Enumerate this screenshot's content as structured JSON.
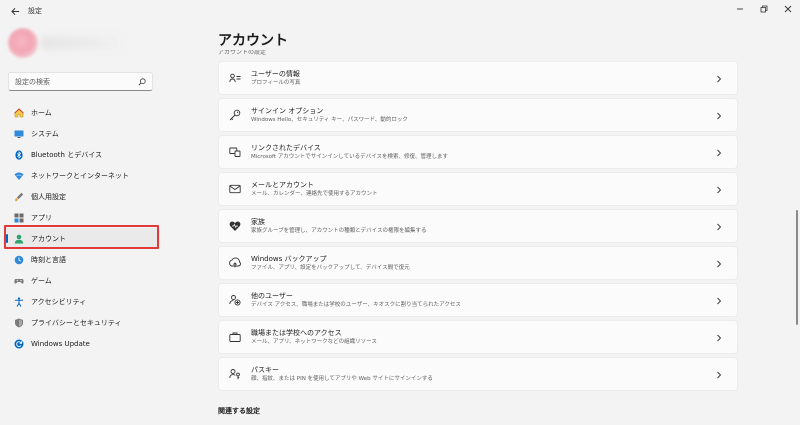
{
  "window": {
    "app_title": "設定"
  },
  "sidebar": {
    "search_placeholder": "設定の検索",
    "items": [
      {
        "label": "ホーム",
        "icon": "home-icon"
      },
      {
        "label": "システム",
        "icon": "monitor-icon"
      },
      {
        "label": "Bluetooth とデバイス",
        "icon": "bluetooth-icon"
      },
      {
        "label": "ネットワークとインターネット",
        "icon": "wifi-icon"
      },
      {
        "label": "個人用設定",
        "icon": "brush-icon"
      },
      {
        "label": "アプリ",
        "icon": "apps-icon"
      },
      {
        "label": "アカウント",
        "icon": "person-icon",
        "selected": true
      },
      {
        "label": "時刻と言語",
        "icon": "globe-clock-icon"
      },
      {
        "label": "ゲーム",
        "icon": "gamepad-icon"
      },
      {
        "label": "アクセシビリティ",
        "icon": "accessibility-icon"
      },
      {
        "label": "プライバシーとセキュリティ",
        "icon": "shield-icon"
      },
      {
        "label": "Windows Update",
        "icon": "update-icon"
      }
    ]
  },
  "main": {
    "page_title": "アカウント",
    "section_cut": "アカウントの設定",
    "cards": [
      {
        "title": "ユーザーの情報",
        "subtitle": "プロフィールの写真",
        "icon": "user-info-icon"
      },
      {
        "title": "サインイン オプション",
        "subtitle": "Windows Hello、セキュリティ キー、パスワード、動的ロック",
        "icon": "key-icon"
      },
      {
        "title": "リンクされたデバイス",
        "subtitle": "Microsoft アカウントでサインインしているデバイスを検索、修復、管理します",
        "icon": "linked-devices-icon"
      },
      {
        "title": "メールとアカウント",
        "subtitle": "メール、カレンダー、連絡先で使用するアカウント",
        "icon": "mail-icon"
      },
      {
        "title": "家族",
        "subtitle": "家族グループを管理し、アカウントの種類とデバイスの権限を編集する",
        "icon": "family-heart-icon"
      },
      {
        "title": "Windows バックアップ",
        "subtitle": "ファイル、アプリ、設定をバックアップして、デバイス間で復元",
        "icon": "backup-icon"
      },
      {
        "title": "他のユーザー",
        "subtitle": "デバイス アクセス、職場または学校のユーザー、キオスクに割り当てられたアクセス",
        "icon": "other-users-icon"
      },
      {
        "title": "職場または学校へのアクセス",
        "subtitle": "メール、アプリ、ネットワークなどの組織リソース",
        "icon": "briefcase-icon"
      },
      {
        "title": "パスキー",
        "subtitle": "顔、指紋、または PIN を使用してアプリや Web サイトにサインインする",
        "icon": "passkey-icon"
      }
    ],
    "related_heading": "関連する設定"
  },
  "colors": {
    "accent": "#0067c0",
    "highlight_border": "#e23a3a",
    "background": "#f3f3f3",
    "card": "#fbfbfb"
  }
}
